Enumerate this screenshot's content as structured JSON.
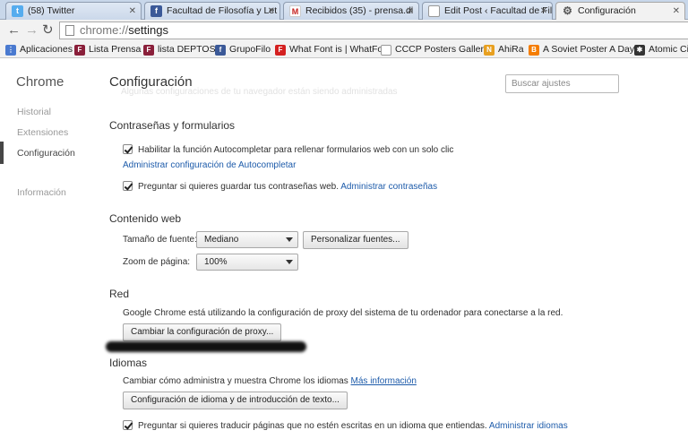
{
  "tabs": [
    {
      "label": "(58) Twitter",
      "icon": "twitter-icon",
      "color": "#55acee"
    },
    {
      "label": "Facultad de Filosofía y Let",
      "icon": "facebook-icon",
      "color": "#3b5998"
    },
    {
      "label": "Recibidos (35) - prensa.di",
      "icon": "gmail-icon",
      "color": "#c5221f"
    },
    {
      "label": "Edit Post ‹ Facultad de Fil",
      "icon": "page-icon",
      "color": "#ffffff"
    },
    {
      "label": "Configuración",
      "icon": "gear-icon",
      "color": "#555555"
    }
  ],
  "address": {
    "scheme": "chrome://",
    "host": "settings"
  },
  "bookmarks": [
    {
      "label": "Aplicaciones",
      "icon": "apps-grid-icon",
      "color": "#4a7ad0"
    },
    {
      "label": "Lista Prensa",
      "icon": "ffyl-icon",
      "color": "#8a1f3a"
    },
    {
      "label": "lista DEPTOS",
      "icon": "ffyl-icon",
      "color": "#8a1f3a"
    },
    {
      "label": "GrupoFilo",
      "icon": "facebook-icon",
      "color": "#3b5998"
    },
    {
      "label": "What Font is | WhatFo",
      "icon": "whatfont-icon",
      "color": "#d42020"
    },
    {
      "label": "CCCP Posters Gallery",
      "icon": "page-icon",
      "color": "#ffffff"
    },
    {
      "label": "AhiRa",
      "icon": "ahira-icon",
      "color": "#e8a020"
    },
    {
      "label": "A Soviet Poster A Day",
      "icon": "blogger-icon",
      "color": "#f57d00"
    },
    {
      "label": "Atomic Cit",
      "icon": "atomic-icon",
      "color": "#333333"
    }
  ],
  "nav": {
    "brand": "Chrome",
    "items": [
      "Historial",
      "Extensiones",
      "Configuración",
      "Información"
    ]
  },
  "page": {
    "title": "Configuración",
    "search_placeholder": "Buscar ajustes",
    "ghost_text": "Algunas configuraciones de tu navegador están siendo administradas"
  },
  "passwords": {
    "heading": "Contraseñas y formularios",
    "autofill_label": "Habilitar la función Autocompletar para rellenar formularios web con un solo clic",
    "autofill_link": "Administrar configuración de Autocompletar",
    "save_label": "Preguntar si quieres guardar tus contraseñas web.",
    "save_link": "Administrar contraseñas"
  },
  "web_content": {
    "heading": "Contenido web",
    "font_size_label": "Tamaño de fuente:",
    "font_size_value": "Mediano",
    "customize_fonts": "Personalizar fuentes...",
    "zoom_label": "Zoom de página:",
    "zoom_value": "100%"
  },
  "network": {
    "heading": "Red",
    "description": "Google Chrome está utilizando la configuración de proxy del sistema de tu ordenador para conectarse a la red.",
    "proxy_button": "Cambiar la configuración de proxy..."
  },
  "languages": {
    "heading": "Idiomas",
    "description": "Cambiar cómo administra y muestra Chrome los idiomas",
    "more_info": "Más información",
    "lang_button": "Configuración de idioma y de introducción de texto...",
    "translate_label": "Preguntar si quieres traducir páginas que no estén escritas en un idioma que entiendas.",
    "translate_link": "Administrar idiomas"
  }
}
